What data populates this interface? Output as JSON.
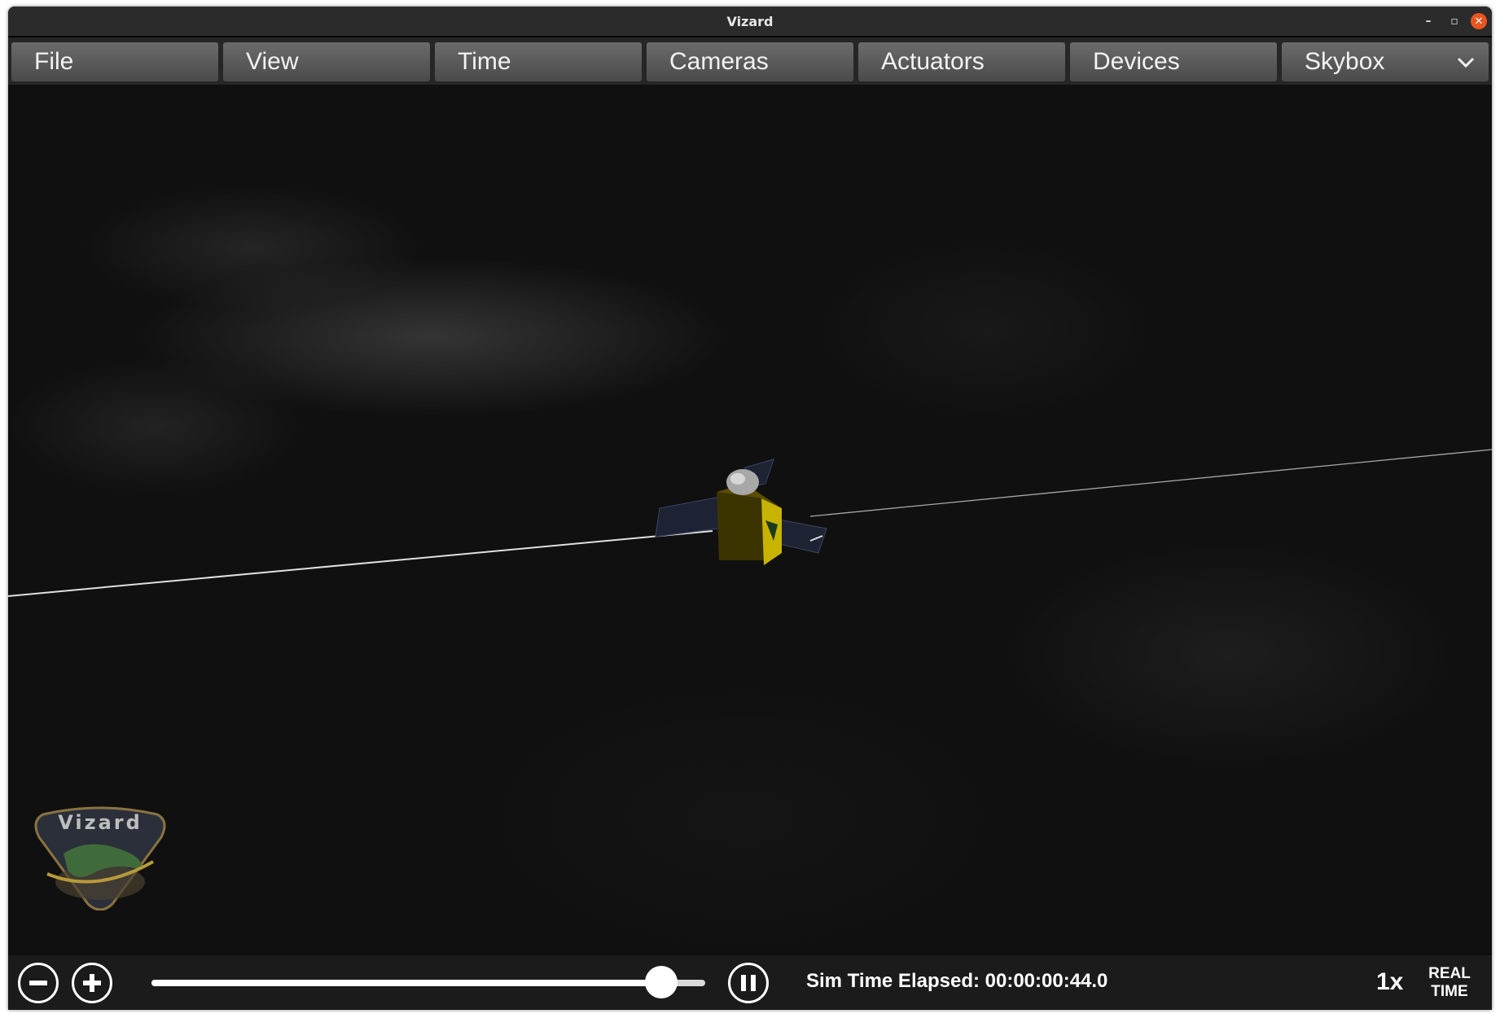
{
  "window": {
    "title": "Vizard"
  },
  "menu": [
    {
      "label": "File"
    },
    {
      "label": "View"
    },
    {
      "label": "Time"
    },
    {
      "label": "Cameras"
    },
    {
      "label": "Actuators"
    },
    {
      "label": "Devices"
    },
    {
      "label": "Skybox",
      "icon": "chevron-down-icon"
    }
  ],
  "logo": {
    "text": "Vizard"
  },
  "playback": {
    "zoom_out_icon": "minus-circle-icon",
    "zoom_in_icon": "plus-circle-icon",
    "pause_icon": "pause-circle-icon",
    "progress": 0.92,
    "elapsed_label": "Sim Time Elapsed: 00:00:00:44.0",
    "speed": "1x",
    "realtime_line1": "REAL",
    "realtime_line2": "TIME"
  },
  "colors": {
    "close_button": "#e95420",
    "menu_button": "#5a5a5a",
    "spacecraft_body": "#c8b400"
  }
}
